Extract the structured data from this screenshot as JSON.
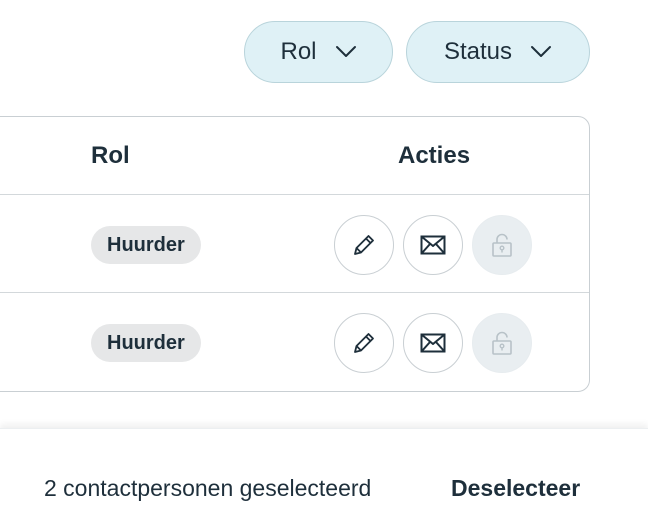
{
  "filters": {
    "rol_label": "Rol",
    "status_label": "Status"
  },
  "table": {
    "headers": {
      "rol": "Rol",
      "acties": "Acties"
    },
    "rows": [
      {
        "rol": "Huurder",
        "unlock_enabled": false
      },
      {
        "rol": "Huurder",
        "unlock_enabled": false
      }
    ]
  },
  "icons": {
    "filter_chevron": "chevron-down-icon",
    "edit": "pencil-icon",
    "mail": "envelope-icon",
    "unlock": "unlocked-padlock-icon"
  },
  "colors": {
    "text": "#1e2f3b",
    "filter_bg": "#dff1f6",
    "filter_border": "#b9d4db",
    "badge_bg": "#e6e7e8",
    "disabled_bg": "#e9eef1",
    "disabled_icon": "#b8c2c8"
  },
  "bottom_bar": {
    "selection_text": "2 contactpersonen geselecteerd",
    "deselect_label": "Deselecteer"
  }
}
